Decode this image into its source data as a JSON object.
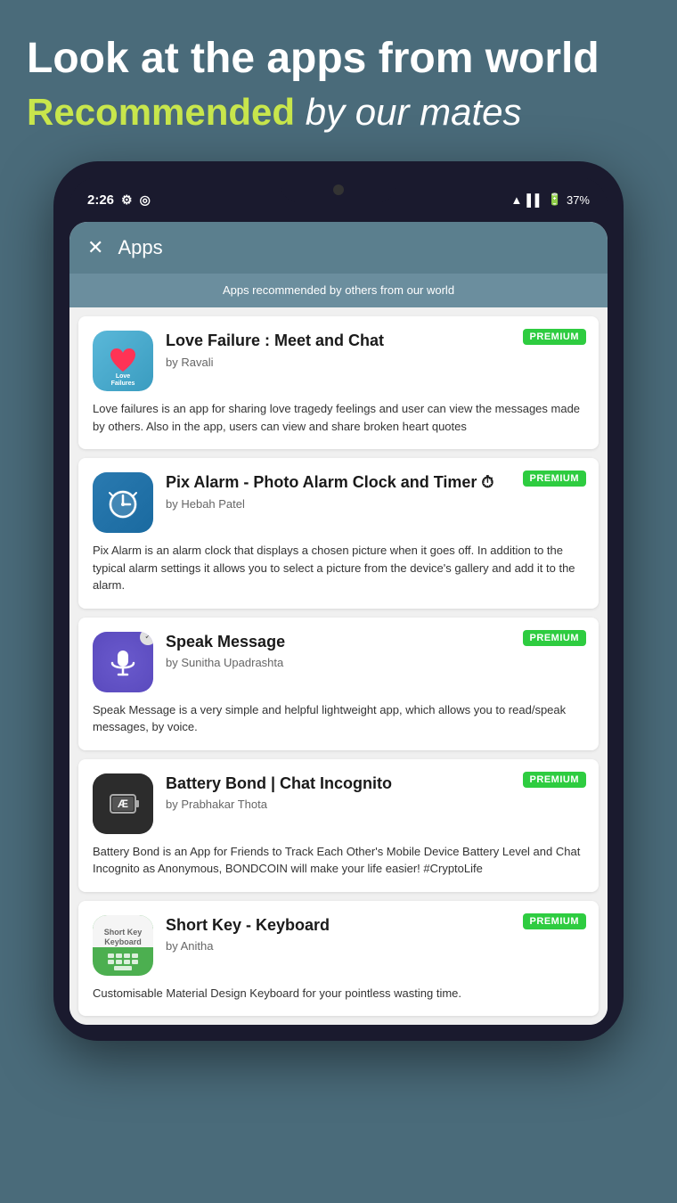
{
  "hero": {
    "line1": "Look at the apps from world",
    "line2_recommended": "Recommended",
    "line2_rest": " by our mates"
  },
  "statusBar": {
    "time": "2:26",
    "battery": "37%"
  },
  "screen": {
    "headerTitle": "Apps",
    "subtitleBar": "Apps recommended by others from our world",
    "apps": [
      {
        "name": "Love Failure : Meet and Chat",
        "author": "by Ravali",
        "badge": "PREMIUM",
        "description": "Love failures is an app for sharing love tragedy feelings and user can view the messages made by others. Also in the app, users can view and share broken heart quotes",
        "iconType": "love"
      },
      {
        "name": "Pix Alarm - Photo Alarm Clock and Timer ⏱",
        "author": "by Hebah Patel",
        "badge": "PREMIUM",
        "description": "Pix Alarm is an alarm clock that displays a chosen picture when it goes off. In addition to the typical alarm settings it allows you to select a picture from the device's gallery and add it to the alarm.",
        "iconType": "pix"
      },
      {
        "name": "Speak Message",
        "author": "by Sunitha Upadrashta",
        "badge": "PREMIUM",
        "description": "Speak Message is a very simple and helpful lightweight app, which allows you to read/speak messages, by voice.",
        "iconType": "speak"
      },
      {
        "name": "Battery Bond | Chat Incognito",
        "author": "by Prabhakar Thota",
        "badge": "PREMIUM",
        "description": "Battery Bond is an App for Friends to Track Each Other's Mobile Device Battery Level and Chat Incognito as Anonymous, BONDCOIN will make your life easier! #CryptoLife",
        "iconType": "battery"
      },
      {
        "name": "Short Key - Keyboard",
        "author": "by Anitha",
        "badge": "PREMIUM",
        "description": "Customisable Material Design Keyboard for your pointless wasting time.",
        "iconType": "keyboard"
      }
    ]
  }
}
